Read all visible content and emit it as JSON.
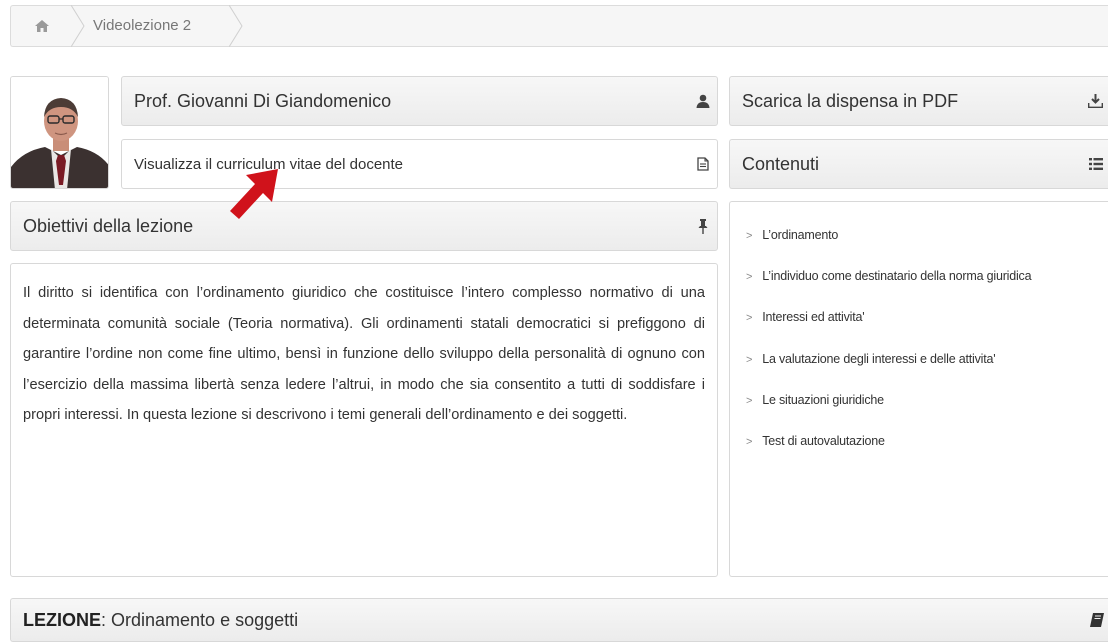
{
  "breadcrumb": {
    "home_icon": "home-icon",
    "current": "Videolezione 2"
  },
  "teacher": {
    "name": "Prof. Giovanni Di Giandomenico",
    "name_icon": "user-icon",
    "cv_link": "Visualizza il curriculum vitae del docente",
    "cv_icon": "document-icon"
  },
  "download": {
    "label": "Scarica la dispensa in PDF",
    "icon": "download-icon"
  },
  "contents": {
    "title": "Contenuti",
    "icon": "list-icon",
    "items": [
      "L’ordinamento",
      "L’individuo come destinatario della norma giuridica",
      "Interessi ed attivita'",
      "La valutazione degli interessi e delle attivita'",
      "Le situazioni giuridiche",
      "Test di autovalutazione"
    ]
  },
  "objectives": {
    "title": "Obiettivi della lezione",
    "icon": "pin-icon",
    "text": "Il diritto si identifica con l’ordinamento giuridico che costituisce l’intero complesso normativo di una determinata comunità sociale (Teoria normativa). Gli ordinamenti statali democratici si prefiggono di garantire l’ordine non come fine ultimo, bensì in funzione dello sviluppo della personalità di ognuno con l’esercizio della massima libertà senza ledere l’altrui, in modo che sia consentito a tutti di soddisfare i propri interessi. In questa lezione si descrivono i temi generali dell’ordinamento e dei soggetti."
  },
  "lesson": {
    "prefix": "LEZIONE",
    "title": ": Ordinamento e soggetti",
    "icon": "book-icon"
  },
  "colors": {
    "annotation_arrow": "#d0121b",
    "panel_header_bg": "#efefef"
  }
}
